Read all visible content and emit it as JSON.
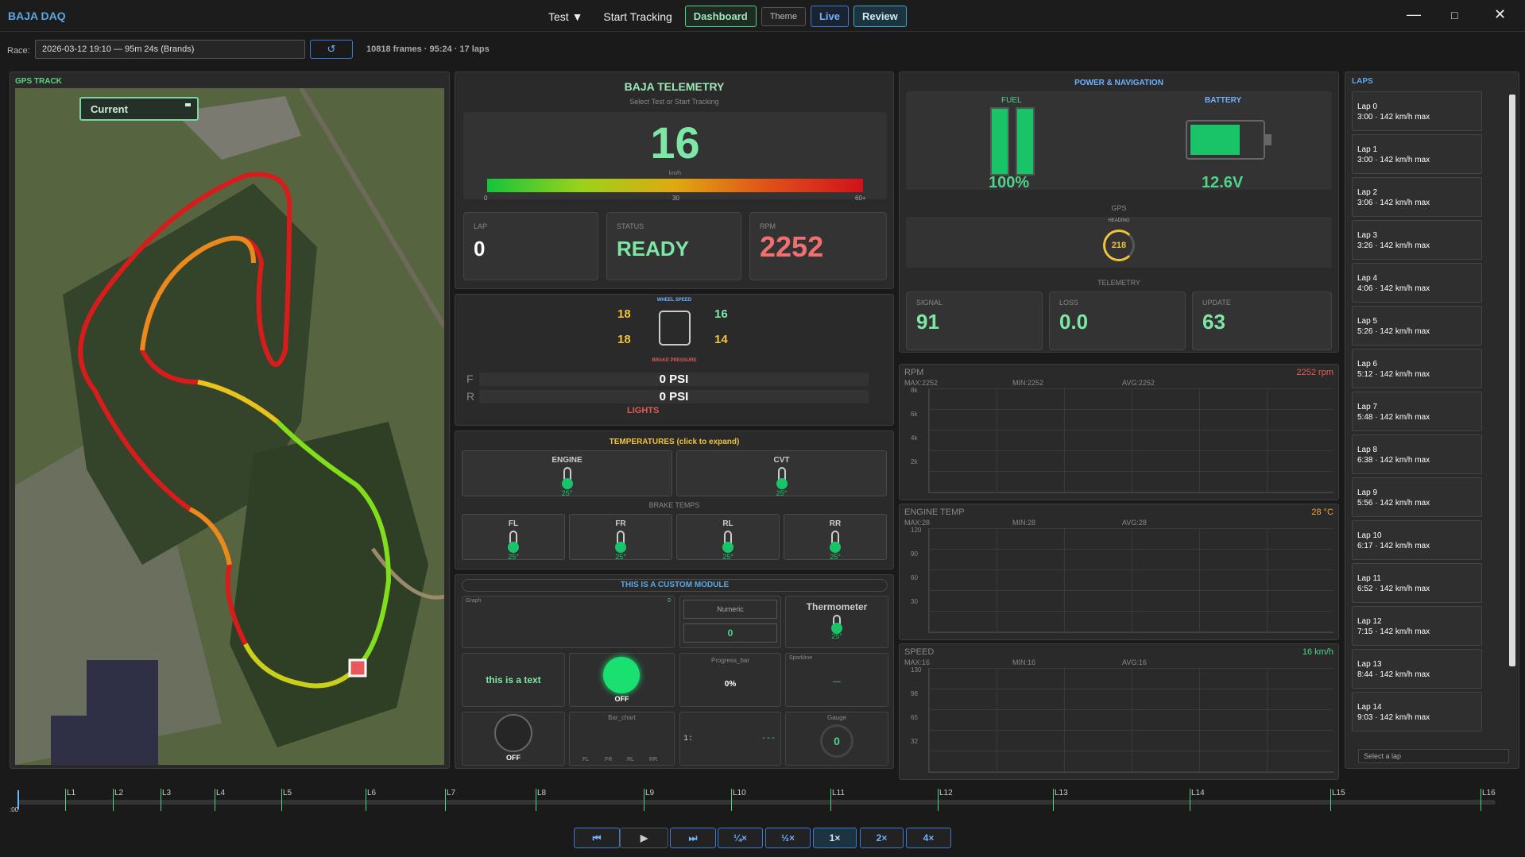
{
  "app": {
    "title": "BAJA DAQ"
  },
  "menu": {
    "test": "Test ▼",
    "start": "Start Tracking",
    "dashboard": "Dashboard",
    "theme": "Theme",
    "live": "Live",
    "review": "Review"
  },
  "window": {
    "minimize": "—",
    "maximize": "□",
    "close": "✕"
  },
  "race": {
    "label": "Race:",
    "value": "2026-03-12 19:10 — 95m 24s (Brands)",
    "refresh": "↺",
    "info": "10818 frames · 95:24 · 17 laps"
  },
  "gps": {
    "title": "GPS TRACK",
    "current": "Current"
  },
  "telemetry": {
    "title": "BAJA TELEMETRY",
    "subtitle": "Select Test or Start Tracking",
    "speed": "16",
    "unit": "km/h",
    "tick0": "0",
    "tick30": "30",
    "tick60": "60+",
    "lap_label": "LAP",
    "lap": "0",
    "status_label": "STATUS",
    "status": "READY",
    "rpm_label": "RPM",
    "rpm": "2252"
  },
  "wheels": {
    "title": "WHEEL SPEED",
    "fl": "18",
    "fr": "16",
    "rl": "18",
    "rr": "14",
    "brake_title": "BRAKE PRESSURE",
    "front_label": "F",
    "front": "0 PSI",
    "rear_label": "R",
    "rear": "0 PSI",
    "lights": "LIGHTS"
  },
  "temps": {
    "title": "TEMPERATURES (click to expand)",
    "engine": "ENGINE",
    "engine_val": "25°",
    "cvt": "CVT",
    "cvt_val": "25°",
    "brake_title": "BRAKE TEMPS",
    "fl": "FL",
    "fr": "FR",
    "rl": "RL",
    "rr": "RR",
    "fl_val": "25°",
    "fr_val": "25°",
    "rl_val": "25°",
    "rr_val": "25°"
  },
  "custom": {
    "title": "THIS IS A CUSTOM MODULE",
    "graph": "Graph",
    "graph_val": "0",
    "numeric": "Numeric",
    "numeric_val": "0",
    "thermo": "Thermometer",
    "thermo_val": "25°",
    "text": "this is a text",
    "led": "OFF",
    "progress": "Progress_bar",
    "progress_val": "0%",
    "progress_fraction": 0,
    "sparkline": "Sparkline",
    "spark_val": "—",
    "knob": "OFF",
    "bar_chart": "Bar_chart",
    "bars": [
      "FL",
      "FR",
      "RL",
      "RR"
    ],
    "counter_label": "1:",
    "counter_val": "---",
    "gauge": "Gauge",
    "gauge_val": "0"
  },
  "power": {
    "title": "POWER & NAVIGATION",
    "fuel": "FUEL",
    "fuel_val": "100%",
    "fuel_fraction": 1,
    "battery": "BATTERY",
    "battery_val": "12.6V",
    "gps": "GPS",
    "heading": "HEADING",
    "heading_val": "218",
    "telemetry": "TELEMETRY",
    "signal": "SIGNAL",
    "signal_val": "91",
    "loss": "LOSS",
    "loss_val": "0.0",
    "update": "UPDATE",
    "update_val": "63"
  },
  "charts": [
    {
      "name": "RPM",
      "value": "2252 rpm",
      "color": "#e85a5a",
      "max": "MAX:2252",
      "min": "MIN:2252",
      "avg": "AVG:2252",
      "ticks": [
        "8k",
        "6k",
        "4k",
        "2k"
      ]
    },
    {
      "name": "ENGINE TEMP",
      "value": "28 °C",
      "color": "#f0a43c",
      "max": "MAX:28",
      "min": "MIN:28",
      "avg": "AVG:28",
      "ticks": [
        "120",
        "90",
        "60",
        "30"
      ]
    },
    {
      "name": "SPEED",
      "value": "16 km/h",
      "color": "#4ed38a",
      "max": "MAX:16",
      "min": "MIN:16",
      "avg": "AVG:16",
      "ticks": [
        "130",
        "98",
        "65",
        "32"
      ]
    }
  ],
  "laps": {
    "title": "LAPS",
    "select": "Select a lap",
    "items": [
      {
        "name": "Lap 0",
        "detail": "3:00 · 142 km/h max"
      },
      {
        "name": "Lap 1",
        "detail": "3:00 · 142 km/h max"
      },
      {
        "name": "Lap 2",
        "detail": "3:06 · 142 km/h max"
      },
      {
        "name": "Lap 3",
        "detail": "3:26 · 142 km/h max"
      },
      {
        "name": "Lap 4",
        "detail": "4:06 · 142 km/h max"
      },
      {
        "name": "Lap 5",
        "detail": "5:26 · 142 km/h max"
      },
      {
        "name": "Lap 6",
        "detail": "5:12 · 142 km/h max"
      },
      {
        "name": "Lap 7",
        "detail": "5:48 · 142 km/h max"
      },
      {
        "name": "Lap 8",
        "detail": "6:38 · 142 km/h max"
      },
      {
        "name": "Lap 9",
        "detail": "5:56 · 142 km/h max"
      },
      {
        "name": "Lap 10",
        "detail": "6:17 · 142 km/h max"
      },
      {
        "name": "Lap 11",
        "detail": "6:52 · 142 km/h max"
      },
      {
        "name": "Lap 12",
        "detail": "7:15 · 142 km/h max"
      },
      {
        "name": "Lap 13",
        "detail": "8:44 · 142 km/h max"
      },
      {
        "name": "Lap 14",
        "detail": "9:03 · 142 km/h max"
      }
    ]
  },
  "timeline": {
    "start": ":00",
    "markers": [
      "L1",
      "L2",
      "L3",
      "L4",
      "L5",
      "L6",
      "L7",
      "L8",
      "L9",
      "L10",
      "L11",
      "L12",
      "L13",
      "L14",
      "L15",
      "L16"
    ]
  },
  "playback": {
    "prev": "⏮",
    "play": "▶",
    "next": "⏭",
    "quarter": "¼×",
    "half": "½×",
    "one": "1×",
    "two": "2×",
    "four": "4×"
  }
}
